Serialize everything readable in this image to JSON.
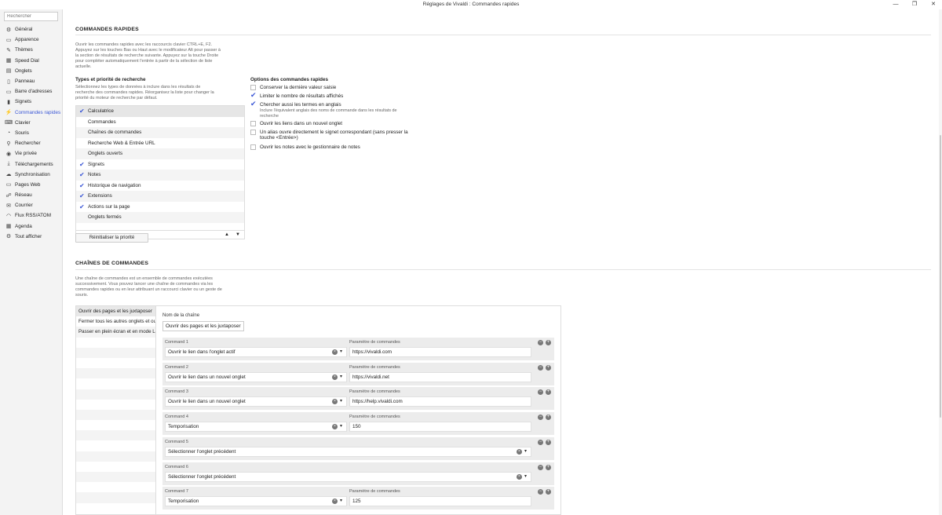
{
  "window": {
    "title": "Réglages de Vivaldi : Commandes rapides",
    "minimize": "—",
    "restore": "❐",
    "close": "✕"
  },
  "sidebar": {
    "search_placeholder": "Rechercher",
    "items": [
      {
        "label": "Général",
        "icon": "gear-icon",
        "glyph": "⚙"
      },
      {
        "label": "Apparence",
        "icon": "appearance-icon",
        "glyph": "▭"
      },
      {
        "label": "Thèmes",
        "icon": "themes-icon",
        "glyph": "✎"
      },
      {
        "label": "Speed Dial",
        "icon": "speed-dial-icon",
        "glyph": "▦"
      },
      {
        "label": "Onglets",
        "icon": "tabs-icon",
        "glyph": "▤"
      },
      {
        "label": "Panneau",
        "icon": "panel-icon",
        "glyph": "▯"
      },
      {
        "label": "Barre d'adresses",
        "icon": "address-bar-icon",
        "glyph": "▭"
      },
      {
        "label": "Signets",
        "icon": "bookmark-icon",
        "glyph": "▮"
      },
      {
        "label": "Commandes rapides",
        "icon": "quick-commands-icon",
        "glyph": "⚡",
        "active": true
      },
      {
        "label": "Clavier",
        "icon": "keyboard-icon",
        "glyph": "⌨"
      },
      {
        "label": "Souris",
        "icon": "mouse-icon",
        "glyph": "◔"
      },
      {
        "label": "Rechercher",
        "icon": "search-icon",
        "glyph": "⚲"
      },
      {
        "label": "Vie privée",
        "icon": "privacy-icon",
        "glyph": "◉"
      },
      {
        "label": "Téléchargements",
        "icon": "download-icon",
        "glyph": "⤓"
      },
      {
        "label": "Synchronisation",
        "icon": "sync-icon",
        "glyph": "☁"
      },
      {
        "label": "Pages Web",
        "icon": "web-pages-icon",
        "glyph": "▭"
      },
      {
        "label": "Réseau",
        "icon": "network-icon",
        "glyph": "☍"
      },
      {
        "label": "Courrier",
        "icon": "mail-icon",
        "glyph": "✉"
      },
      {
        "label": "Flux RSS/ATOM",
        "icon": "rss-icon",
        "glyph": "◠"
      },
      {
        "label": "Agenda",
        "icon": "calendar-icon",
        "glyph": "▦"
      },
      {
        "label": "Tout afficher",
        "icon": "show-all-icon",
        "glyph": "⚙"
      }
    ]
  },
  "quick_commands": {
    "title": "COMMANDES RAPIDES",
    "description": "Ouvrir les commandes rapides avec les raccourcis clavier CTRL+E, F2. Appuyez sur les touches Bas ou Haut avec le modificateur Alt pour passer à la section de résultats de recherche suivante. Appuyez sur la touche Droite pour compléter automatiquement l'entrée à partir de la sélection de liste actuelle.",
    "types_title": "Types et priorité de recherche",
    "types_desc": "Sélectionnez les types de données à inclure dans les résultats de recherche des commandes rapides. Réorganisez la liste pour changer la priorité du moteur de recherche par défaut.",
    "types": [
      {
        "label": "Calculatrice",
        "checked": true,
        "selected": true
      },
      {
        "label": "Commandes",
        "checked": false
      },
      {
        "label": "Chaînes de commandes",
        "checked": false
      },
      {
        "label": "Recherche Web & Entrée URL",
        "checked": false
      },
      {
        "label": "Onglets ouverts",
        "checked": false
      },
      {
        "label": "Signets",
        "checked": true
      },
      {
        "label": "Notes",
        "checked": true
      },
      {
        "label": "Historique de navigation",
        "checked": true
      },
      {
        "label": "Extensions",
        "checked": true
      },
      {
        "label": "Actions sur la page",
        "checked": true
      },
      {
        "label": "Onglets fermés",
        "checked": false
      }
    ],
    "move_up": "▲",
    "move_down": "▼",
    "reset_button": "Réinitialiser la priorité",
    "options_title": "Options des commandes rapides",
    "options": [
      {
        "label": "Conserver la dernière valeur saisie",
        "checked": false,
        "sub": ""
      },
      {
        "label": "Limiter le nombre de résultats affichés",
        "checked": true,
        "sub": ""
      },
      {
        "label": "Chercher aussi les termes en anglais",
        "checked": true,
        "sub": "Inclure l'équivalent anglais des noms de commande dans les résultats de recherche"
      },
      {
        "label": "Ouvrir les liens dans un nouvel onglet",
        "checked": false,
        "sub": ""
      },
      {
        "label": "Un alias ouvre directement le signet correspondant (sans presser la touche <Entrée>)",
        "checked": false,
        "sub": ""
      },
      {
        "label": "Ouvrir les notes avec le gestionnaire de notes",
        "checked": false,
        "sub": ""
      }
    ]
  },
  "command_chains": {
    "title": "CHAÎNES DE COMMANDES",
    "description": "Une chaîne de commandes est un ensemble de commandes exécutées successivement. Vous pouvez lancer une chaîne de commandes via les commandes rapides ou en leur attribuant un raccourci clavier ou un geste de souris.",
    "chains": [
      {
        "label": "Ouvrir des pages et les juxtaposer",
        "selected": true
      },
      {
        "label": "Fermer tous les autres onglets et ouvrir"
      },
      {
        "label": "Passer en plein écran et en mode Lecture"
      }
    ],
    "chain_name_label": "Nom de la chaîne",
    "chain_name_value": "Ouvrir des pages et les juxtaposer",
    "param_label": "Paramètre de commandes",
    "commands": [
      {
        "label": "Command 1",
        "value": "Ouvrir le lien dans l'onglet actif",
        "param": "https://vivaldi.com"
      },
      {
        "label": "Command 2",
        "value": "Ouvrir le lien dans un nouvel onglet",
        "param": "https://vivaldi.net"
      },
      {
        "label": "Command 3",
        "value": "Ouvrir le lien dans un nouvel onglet",
        "param": "https://help.vivaldi.com"
      },
      {
        "label": "Command 4",
        "value": "Temporisation",
        "param": "150"
      },
      {
        "label": "Command 5",
        "value": "Sélectionner l'onglet précédent",
        "param": null
      },
      {
        "label": "Command 6",
        "value": "Sélectionner l'onglet précédent",
        "param": null
      },
      {
        "label": "Command 7",
        "value": "Temporisation",
        "param": "125"
      }
    ]
  }
}
